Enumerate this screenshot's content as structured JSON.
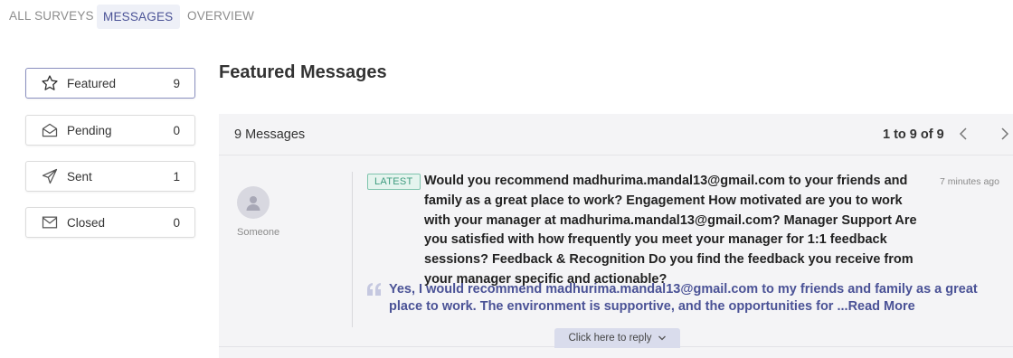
{
  "tabs": [
    "ALL SURVEYS",
    "MESSAGES",
    "OVERVIEW"
  ],
  "sidebar": {
    "items": [
      {
        "label": "Featured",
        "count": "9",
        "icon": "star-icon"
      },
      {
        "label": "Pending",
        "count": "0",
        "icon": "envelope-open-icon"
      },
      {
        "label": "Sent",
        "count": "1",
        "icon": "paper-plane-icon"
      },
      {
        "label": "Closed",
        "count": "0",
        "icon": "envelope-icon"
      }
    ]
  },
  "main": {
    "title": "Featured Messages",
    "message_count": "9 Messages",
    "pagination": "1 to 9 of 9",
    "message": {
      "author": "Someone",
      "badge": "LATEST",
      "time": "7 minutes ago",
      "question": "Would you recommend madhurima.mandal13@gmail.com to your friends and family as a great place to work? Engagement How motivated are you to work with your manager at madhurima.mandal13@gmail.com? Manager Support Are you satisfied with how frequently you meet your manager for 1:1 feedback sessions? Feedback & Recognition Do you find the feedback you receive from your manager specific and actionable?",
      "answer": "Yes, I would recommend madhurima.mandal13@gmail.com to my friends and family as a great place to work. The environment is supportive, and the opportunities for ",
      "read_more": "...Read More",
      "reply_label": "Click here to reply"
    }
  },
  "colors": {
    "accent": "#4a5296",
    "badge_green": "#3e9b7f",
    "panel_bg": "#f4f4f6"
  }
}
